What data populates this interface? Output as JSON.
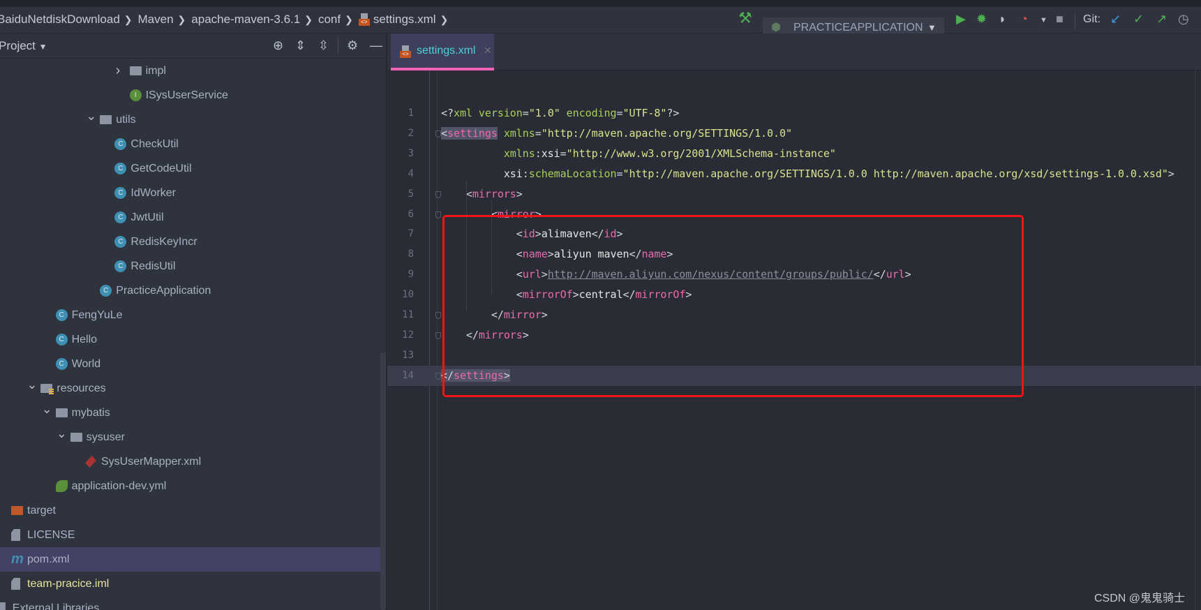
{
  "breadcrumb": [
    "BaiduNetdiskDownload",
    "Maven",
    "apache-maven-3.6.1",
    "conf",
    "settings.xml"
  ],
  "toolbar": {
    "run_config": "PRACTICEAPPLICATION",
    "git_label": "Git:",
    "icons": [
      "hammer-icon",
      "run-icon",
      "debug-icon",
      "coverage-icon",
      "profiler-icon",
      "stop-icon",
      "git-update-icon",
      "git-commit-icon",
      "git-push-icon",
      "history-icon"
    ]
  },
  "sidebar": {
    "title": "Project",
    "tree": [
      {
        "label": "impl",
        "icon": "folder",
        "level": 8,
        "expand": "collapsed"
      },
      {
        "label": "ISysUserService",
        "icon": "interface",
        "level": 8
      },
      {
        "label": "utils",
        "icon": "folder",
        "level": 6,
        "expand": "expanded"
      },
      {
        "label": "CheckUtil",
        "icon": "class",
        "level": 7
      },
      {
        "label": "GetCodeUtil",
        "icon": "class",
        "level": 7
      },
      {
        "label": "IdWorker",
        "icon": "class",
        "level": 7
      },
      {
        "label": "JwtUtil",
        "icon": "class",
        "level": 7
      },
      {
        "label": "RedisKeyIncr",
        "icon": "class",
        "level": 7
      },
      {
        "label": "RedisUtil",
        "icon": "class",
        "level": 7
      },
      {
        "label": "PracticeApplication",
        "icon": "class",
        "level": 6
      },
      {
        "label": "FengYuLe",
        "icon": "class",
        "level": 3
      },
      {
        "label": "Hello",
        "icon": "class",
        "level": 3
      },
      {
        "label": "World",
        "icon": "class",
        "level": 3
      },
      {
        "label": "resources",
        "icon": "resources",
        "level": 2,
        "expand": "expanded"
      },
      {
        "label": "mybatis",
        "icon": "folder",
        "level": 3,
        "expand": "expanded"
      },
      {
        "label": "sysuser",
        "icon": "folder",
        "level": 4,
        "expand": "expanded"
      },
      {
        "label": "SysUserMapper.xml",
        "icon": "xml",
        "level": 5
      },
      {
        "label": "application-dev.yml",
        "icon": "yml",
        "level": 3
      },
      {
        "label": "target",
        "icon": "target",
        "level": 0
      },
      {
        "label": "LICENSE",
        "icon": "file",
        "level": 0
      },
      {
        "label": "pom.xml",
        "icon": "maven",
        "level": 0,
        "selected": true
      },
      {
        "label": "team-pracice.iml",
        "icon": "iml",
        "level": 0,
        "color": "#e8e4a0"
      },
      {
        "label": "External Libraries",
        "icon": "libraries",
        "level": -1
      }
    ]
  },
  "editor": {
    "tab": "settings.xml",
    "current_line": 14,
    "lines": [
      [
        [
          "br",
          "<?"
        ],
        [
          "pi",
          "xml "
        ],
        [
          "attr",
          "version"
        ],
        [
          "br",
          "="
        ],
        [
          "str",
          "\"1.0\""
        ],
        [
          "br",
          " "
        ],
        [
          "attr",
          "encoding"
        ],
        [
          "br",
          "="
        ],
        [
          "str",
          "\"UTF-8\""
        ],
        [
          "br",
          "?>"
        ]
      ],
      [
        [
          "hlbr",
          "<"
        ],
        [
          "hltag",
          "settings"
        ],
        [
          "br",
          " "
        ],
        [
          "attr",
          "xmlns"
        ],
        [
          "br",
          "="
        ],
        [
          "str",
          "\"http://maven.apache.org/SETTINGS/1.0.0\""
        ]
      ],
      [
        [
          "br",
          "          "
        ],
        [
          "attr",
          "xmlns"
        ],
        [
          "br",
          ":"
        ],
        [
          "text",
          "xsi"
        ],
        [
          "br",
          "="
        ],
        [
          "str",
          "\"http://www.w3.org/2001/XMLSchema-instance\""
        ]
      ],
      [
        [
          "br",
          "          "
        ],
        [
          "text",
          "xsi"
        ],
        [
          "br",
          ":"
        ],
        [
          "attr",
          "schemaLocation"
        ],
        [
          "br",
          "="
        ],
        [
          "str",
          "\"http://maven.apache.org/SETTINGS/1.0.0 http://maven.apache.org/xsd/settings-1.0.0.xsd\""
        ],
        [
          "br",
          ">"
        ]
      ],
      [
        [
          "br",
          "    <"
        ],
        [
          "tag",
          "mirrors"
        ],
        [
          "br",
          ">"
        ]
      ],
      [
        [
          "br",
          "        <"
        ],
        [
          "tag",
          "mirror"
        ],
        [
          "br",
          ">"
        ]
      ],
      [
        [
          "br",
          "            <"
        ],
        [
          "tag",
          "id"
        ],
        [
          "br",
          ">"
        ],
        [
          "text",
          "alimaven"
        ],
        [
          "br",
          "</"
        ],
        [
          "tag",
          "id"
        ],
        [
          "br",
          ">"
        ]
      ],
      [
        [
          "br",
          "            <"
        ],
        [
          "tag",
          "name"
        ],
        [
          "br",
          ">"
        ],
        [
          "text",
          "aliyun maven"
        ],
        [
          "br",
          "</"
        ],
        [
          "tag",
          "name"
        ],
        [
          "br",
          ">"
        ]
      ],
      [
        [
          "br",
          "            <"
        ],
        [
          "tag",
          "url"
        ],
        [
          "br",
          ">"
        ],
        [
          "url",
          "http://maven.aliyun.com/nexus/content/groups/public/"
        ],
        [
          "br",
          "</"
        ],
        [
          "tag",
          "url"
        ],
        [
          "br",
          ">"
        ]
      ],
      [
        [
          "br",
          "            <"
        ],
        [
          "tag",
          "mirrorOf"
        ],
        [
          "br",
          ">"
        ],
        [
          "text",
          "central"
        ],
        [
          "br",
          "</"
        ],
        [
          "tag",
          "mirrorOf"
        ],
        [
          "br",
          ">"
        ]
      ],
      [
        [
          "br",
          "        </"
        ],
        [
          "tag",
          "mirror"
        ],
        [
          "br",
          ">"
        ]
      ],
      [
        [
          "br",
          "    </"
        ],
        [
          "tag",
          "mirrors"
        ],
        [
          "br",
          ">"
        ]
      ],
      [],
      [
        [
          "hlbr",
          "</"
        ],
        [
          "hltag",
          "settings"
        ],
        [
          "hlbr",
          ">"
        ]
      ]
    ],
    "fold_lines": [
      2,
      5,
      6,
      11,
      12,
      14
    ]
  },
  "annotation_color": "#f01414",
  "watermark": "CSDN @鬼鬼骑士"
}
